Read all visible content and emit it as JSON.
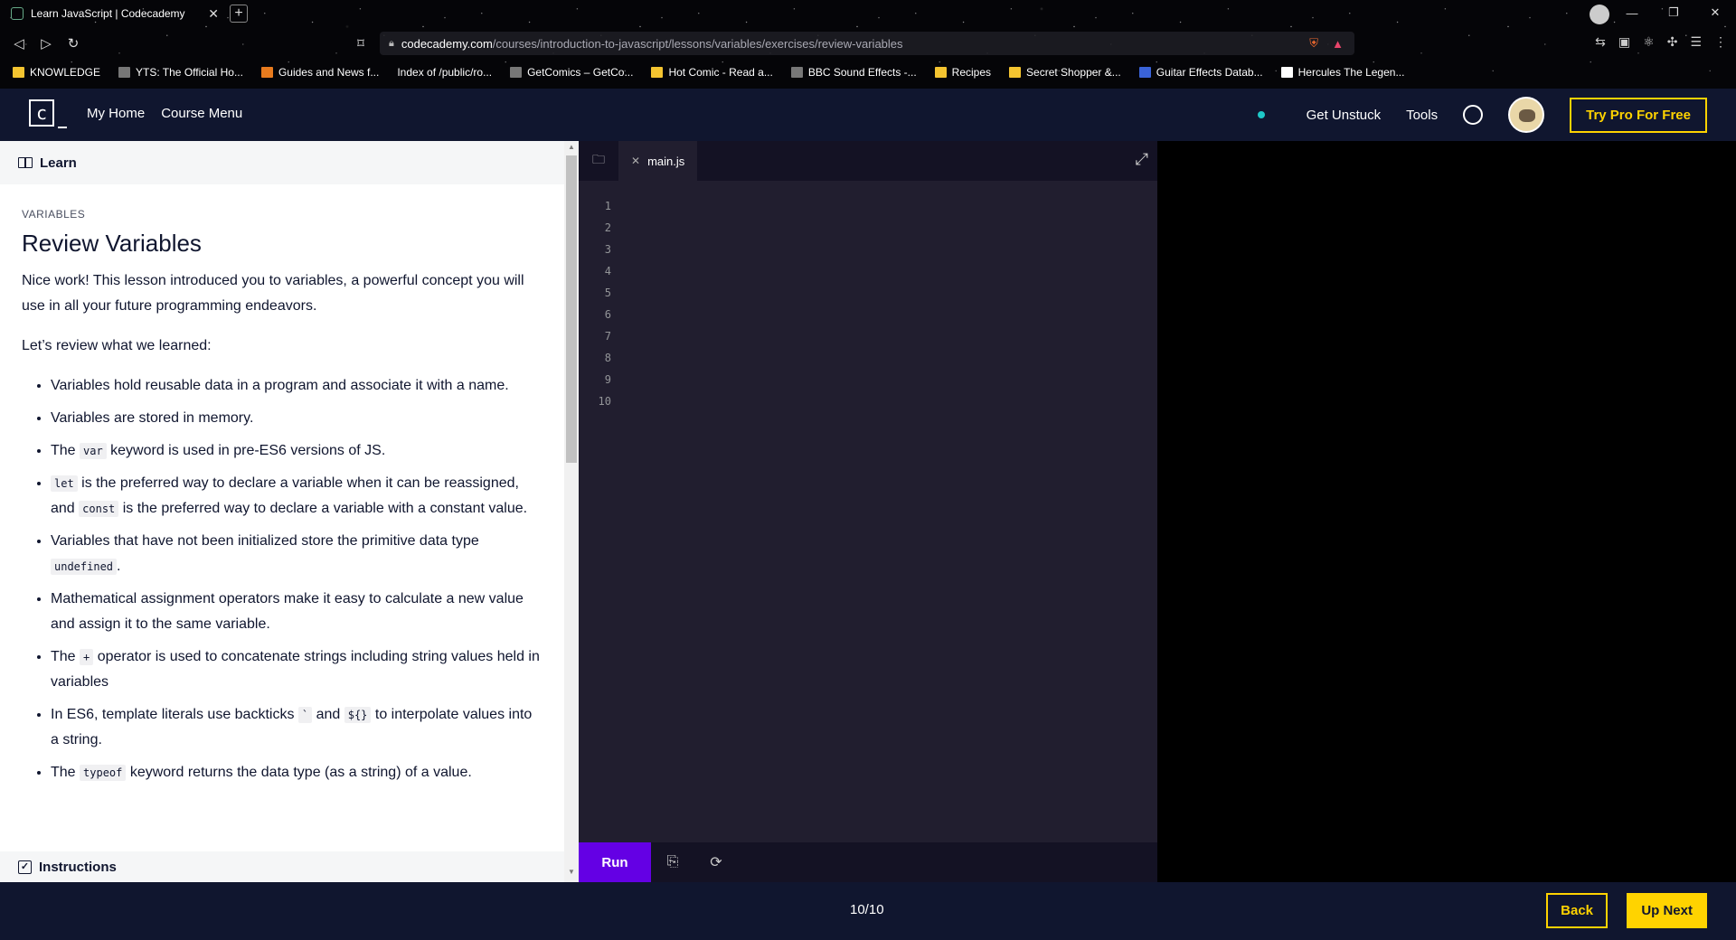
{
  "browser": {
    "tab_title": "Learn JavaScript | Codecademy",
    "tab_close": "✕",
    "new_tab": "+",
    "url_host": "codecademy.com",
    "url_path": "/courses/introduction-to-javascript/lessons/variables/exercises/review-variables",
    "bookmarks": [
      {
        "label": "KNOWLEDGE",
        "icon": "folder-icon"
      },
      {
        "label": "YTS: The Official Ho...",
        "icon": "yts-icon"
      },
      {
        "label": "Guides and News f...",
        "icon": "guides-icon"
      },
      {
        "label": "Index of /public/ro...",
        "icon": "page-icon"
      },
      {
        "label": "GetComics – GetCo...",
        "icon": "getcomics-icon"
      },
      {
        "label": "Hot Comic - Read a...",
        "icon": "hotcomic-icon"
      },
      {
        "label": "BBC Sound Effects -...",
        "icon": "bbc-icon"
      },
      {
        "label": "Recipes",
        "icon": "folder-icon"
      },
      {
        "label": "Secret Shopper &...",
        "icon": "folder-icon"
      },
      {
        "label": "Guitar Effects Datab...",
        "icon": "guitar-icon"
      },
      {
        "label": "Hercules The Legen...",
        "icon": "d-icon"
      }
    ]
  },
  "header": {
    "logo_letter": "c",
    "my_home": "My Home",
    "course_menu": "Course Menu",
    "get_unstuck": "Get Unstuck",
    "tools": "Tools",
    "try_pro": "Try Pro For Free"
  },
  "learn": {
    "tab_label": "Learn",
    "eyebrow": "VARIABLES",
    "title": "Review Variables",
    "intro": "Nice work! This lesson introduced you to variables, a powerful concept you will use in all your future programming endeavors.",
    "review_lead": "Let’s review what we learned:",
    "b1": "Variables hold reusable data in a program and associate it with a name.",
    "b2": "Variables are stored in memory.",
    "b3_pre": "The ",
    "b3_code": "var",
    "b3_post": " keyword is used in pre-ES6 versions of JS.",
    "b4_code1": "let",
    "b4_mid": " is the preferred way to declare a variable when it can be reassigned, and ",
    "b4_code2": "const",
    "b4_post": " is the preferred way to declare a variable with a constant value.",
    "b5_pre": "Variables that have not been initialized store the primitive data type ",
    "b5_code": "undefined",
    "b5_post": ".",
    "b6": "Mathematical assignment operators make it easy to calculate a new value and assign it to the same variable.",
    "b7_pre": "The ",
    "b7_code": "+",
    "b7_post": " operator is used to concatenate strings including string values held in variables",
    "b8_pre": "In ES6, template literals use backticks ",
    "b8_code1": "`",
    "b8_mid": " and ",
    "b8_code2": "${}",
    "b8_post": " to interpolate values into a string.",
    "b9_pre": "The ",
    "b9_code": "typeof",
    "b9_post": " keyword returns the data type (as a string) of a value.",
    "instructions_label": "Instructions"
  },
  "editor": {
    "file_name": "main.js",
    "line_numbers": [
      "1",
      "2",
      "3",
      "4",
      "5",
      "6",
      "7",
      "8",
      "9",
      "10"
    ],
    "run_label": "Run"
  },
  "footer": {
    "progress": "10/10",
    "back": "Back",
    "up_next": "Up Next"
  },
  "colors": {
    "header_bg": "#10162f",
    "accent_yellow": "#ffd300",
    "run_purple": "#6400e4",
    "editor_bg": "#211e2f"
  }
}
